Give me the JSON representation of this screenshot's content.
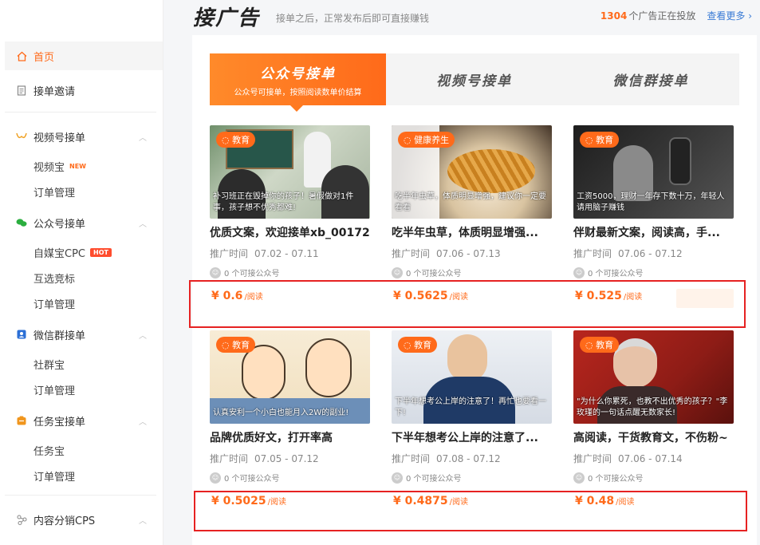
{
  "sidebar": {
    "items": [
      {
        "label": "首页",
        "icon": "home-icon",
        "active": true
      },
      {
        "label": "接单邀请",
        "icon": "document-icon"
      },
      {
        "label": "视频号接单",
        "icon": "video-channel-icon",
        "subs": [
          {
            "label": "视频宝",
            "badge": "NEW"
          },
          {
            "label": "订单管理"
          }
        ]
      },
      {
        "label": "公众号接单",
        "icon": "wechat-icon",
        "subs": [
          {
            "label": "自媒宝CPC",
            "badge": "HOT"
          },
          {
            "label": "互选竞标"
          },
          {
            "label": "订单管理"
          }
        ]
      },
      {
        "label": "微信群接单",
        "icon": "group-icon",
        "subs": [
          {
            "label": "社群宝"
          },
          {
            "label": "订单管理"
          }
        ]
      },
      {
        "label": "任务宝接单",
        "icon": "task-icon",
        "subs": [
          {
            "label": "任务宝"
          },
          {
            "label": "订单管理"
          }
        ]
      },
      {
        "label": "内容分销CPS",
        "icon": "distribution-icon"
      }
    ]
  },
  "header": {
    "title": "接广告",
    "subtitle": "接单之后，正常发布后即可直接赚钱",
    "count": "1304",
    "count_text": "个广告正在投放",
    "more": "查看更多",
    "more_arrow": "›"
  },
  "tabs": [
    {
      "label": "公众号接单",
      "sub": "公众号可接单，按照阅读数单价结算",
      "active": true
    },
    {
      "label": "视频号接单"
    },
    {
      "label": "微信群接单"
    }
  ],
  "card_common": {
    "date_label": "推广时间",
    "accounts_text": "0 个可接公众号",
    "price_prefix": "¥",
    "price_unit": "/阅读"
  },
  "cards": [
    {
      "category": "教育",
      "caption": "补习班正在毁掉你的孩子！暑假做对1件事，孩子想不优秀都难!",
      "title": "优质文案，欢迎接单xb_00172",
      "date": "07.02 - 07.11",
      "price": "0.6"
    },
    {
      "category": "健康养生",
      "caption": "吃半年虫草，体质明显增强，建议你一定要看看",
      "title": "吃半年虫草，体质明显增强...",
      "date": "07.06 - 07.13",
      "price": "0.5625"
    },
    {
      "category": "教育",
      "caption": "工资5000，理财一年存下数十万，年轻人请用脑子赚钱",
      "title": "伴财最新文案，阅读高，手...",
      "date": "07.06 - 07.12",
      "price": "0.525"
    },
    {
      "category": "教育",
      "caption": "认真安利一个小白也能月入2W的副业!",
      "title": "品牌优质好文，打开率高",
      "date": "07.05 - 07.12",
      "price": "0.5025"
    },
    {
      "category": "教育",
      "caption": "下半年想考公上岸的注意了！再忙也要看一下!",
      "title": "下半年想考公上岸的注意了...",
      "date": "07.08 - 07.12",
      "price": "0.4875"
    },
    {
      "category": "教育",
      "caption": "\"为什么你累死，也教不出优秀的孩子？\"李玫瑾的一句话点醒无数家长!",
      "title": "高阅读，干货教育文，不伤粉~",
      "date": "07.06 - 07.14",
      "price": "0.48"
    }
  ],
  "colors": {
    "accent": "#ff6a1a",
    "highlight_box": "#e62222",
    "link": "#3a7bd5"
  }
}
